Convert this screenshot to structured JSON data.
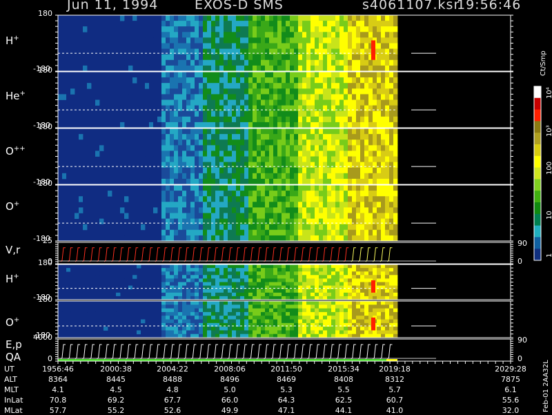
{
  "header": {
    "date": "Jun 11, 1994",
    "instrument": "EXOS-D SMS",
    "file": "s4061107.ksr",
    "time": "19:56:46"
  },
  "panels": [
    {
      "species": "H",
      "charge": "+",
      "ymax": "180",
      "ymin": "-180"
    },
    {
      "species": "He",
      "charge": "+",
      "ymax": "180",
      "ymin": "-180"
    },
    {
      "species": "O",
      "charge": "++",
      "ymax": "180",
      "ymin": "-180"
    },
    {
      "species": "O",
      "charge": "+",
      "ymax": "180",
      "ymin": "-180"
    },
    {
      "species": "V,r",
      "charge": "",
      "ymax": "25",
      "ymin": "0",
      "rmax": "90",
      "rmin": "0"
    },
    {
      "species": "H",
      "charge": "+",
      "ymax": "180",
      "ymin": "-180"
    },
    {
      "species": "O",
      "charge": "+",
      "ymax": "180",
      "ymin": "-180"
    },
    {
      "species": "E,p",
      "charge": "",
      "ymax": "4000",
      "ymin": "0",
      "rmax": "90",
      "rmin": "0",
      "sub": "QA"
    }
  ],
  "colorbar": {
    "unit": "Ct/Smp",
    "labels": [
      "10⁴",
      "10³",
      "100",
      "10",
      "1"
    ],
    "colors": [
      "#ffffff",
      "#c80000",
      "#ff2000",
      "#8c7a10",
      "#b0a020",
      "#d8cc10",
      "#ffff00",
      "#d0e620",
      "#80d020",
      "#40b010",
      "#108a10",
      "#008050",
      "#20b0c0",
      "#1060a0",
      "#103080"
    ]
  },
  "ephemeris": {
    "row_labels": [
      "UT",
      "ALT",
      "MLT",
      "InLat",
      "MLat"
    ],
    "columns": [
      [
        "1956:46",
        "8364",
        "4.1",
        "70.8",
        "57.7"
      ],
      [
        "2000:38",
        "8445",
        "4.5",
        "69.2",
        "55.2"
      ],
      [
        "2004:22",
        "8488",
        "4.8",
        "67.7",
        "52.6"
      ],
      [
        "2008:06",
        "8496",
        "5.0",
        "66.0",
        "49.9"
      ],
      [
        "2011:50",
        "8469",
        "5.3",
        "64.3",
        "47.1"
      ],
      [
        "2015:34",
        "8408",
        "5.5",
        "62.5",
        "44.1"
      ],
      [
        "2019:18",
        "8312",
        "5.7",
        "60.7",
        "41.0"
      ],
      [
        "2029:28",
        "7875",
        "6.1",
        "55.6",
        "32.0"
      ]
    ]
  },
  "side_label": "Feb-01 2AA32L",
  "chart_data": {
    "type": "heatmap",
    "title": "Jun 11, 1994 EXOS-D SMS",
    "xlabel": "UT",
    "x_ticks": [
      "1956:46",
      "2000:38",
      "2004:22",
      "2008:06",
      "2011:50",
      "2015:34",
      "2019:18",
      "2029:28"
    ],
    "y_range": [
      -180,
      180
    ],
    "color_scale": "log",
    "color_range": [
      1,
      10000
    ],
    "series": [
      {
        "name": "H+",
        "ylim": [
          -180,
          180
        ]
      },
      {
        "name": "He+",
        "ylim": [
          -180,
          180
        ]
      },
      {
        "name": "O++",
        "ylim": [
          -180,
          180
        ]
      },
      {
        "name": "O+",
        "ylim": [
          -180,
          180
        ]
      },
      {
        "name": "V,r",
        "ylim": [
          0,
          25
        ],
        "right_ylim": [
          0,
          90
        ]
      },
      {
        "name": "H+",
        "ylim": [
          -180,
          180
        ]
      },
      {
        "name": "O+",
        "ylim": [
          -180,
          180
        ]
      },
      {
        "name": "E,p",
        "ylim": [
          0,
          4000
        ],
        "right_ylim": [
          0,
          90
        ]
      }
    ]
  }
}
